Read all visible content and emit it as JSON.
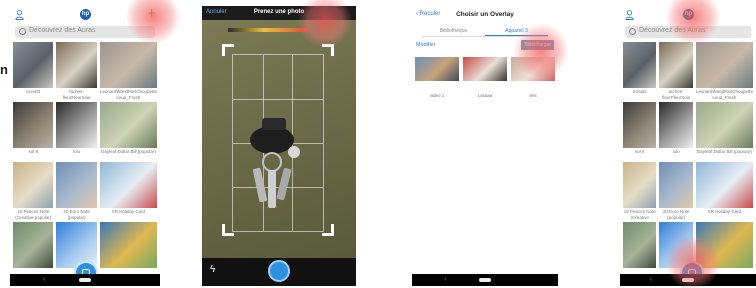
{
  "edge_letter": "n",
  "screen1": {
    "search_placeholder": "Découvrez des Auras",
    "items": [
      {
        "caption": "Ironat3",
        "colors": [
          "#8a8f96",
          "#5b6068",
          "#c9c7c0"
        ]
      },
      {
        "caption": "taches-fleurFleurSoie",
        "colors": [
          "#7a6a55",
          "#d9d2c4",
          "#3d3a35"
        ]
      },
      {
        "caption": "LeonardWandPartChoupette Leua_Fresh",
        "colors": [
          "#9c9590",
          "#c8b9a9",
          "#6a7a80"
        ]
      },
      {
        "caption": "sol 8",
        "colors": [
          "#3b3a3f",
          "#8a8170",
          "#b8b2a8"
        ]
      },
      {
        "caption": "lolo",
        "colors": [
          "#2a2a2a",
          "#9a9a9a",
          "#efefef"
        ]
      },
      {
        "caption": "Dayleaf Dollar Bill (popular)",
        "colors": [
          "#9aa88a",
          "#cfd3b8",
          "#6c7a5a"
        ]
      },
      {
        "caption": "10 Peaces Note (Creative popular)",
        "colors": [
          "#c9b28a",
          "#e6dcc6",
          "#8fa3b0"
        ]
      },
      {
        "caption": "20 Euro Note (popular)",
        "colors": [
          "#6f8fb8",
          "#a9b9cc",
          "#e3c9a8"
        ]
      },
      {
        "caption": "XR Holiday Card",
        "colors": [
          "#8fb6d8",
          "#e8eef5",
          "#c94a4a"
        ]
      },
      {
        "caption": "",
        "colors": [
          "#6f8a6a",
          "#a7b49a",
          "#3d4a3a"
        ]
      },
      {
        "caption": "",
        "colors": [
          "#2f7fd8",
          "#9fc6ee",
          "#e8f2fb"
        ]
      },
      {
        "caption": "",
        "colors": [
          "#3a78b8",
          "#e0b850",
          "#7aa860"
        ]
      }
    ]
  },
  "screen2": {
    "cancel_label": "Annuler",
    "title": "Prenez une photo"
  },
  "screen3": {
    "back_label": "Reculer",
    "title": "Choisir un Overlay",
    "tabs": [
      "Bibliothèque",
      "Appareil 3"
    ],
    "modify_label": "Modifier",
    "upload_label": "Télécharger",
    "items": [
      {
        "caption": "video 1",
        "colors": [
          "#6b8fb8",
          "#c9a27a",
          "#3a4a5a"
        ]
      },
      {
        "caption": "Lasaaa",
        "colors": [
          "#c94a4a",
          "#e8e0d6",
          "#3a3030"
        ]
      },
      {
        "caption": "test",
        "colors": [
          "#c9a89a",
          "#f0e0d8",
          "#d06060"
        ]
      }
    ]
  },
  "screen4": {
    "search_placeholder": "Découvrez des Auras",
    "items": [
      {
        "caption": "Ironat3",
        "colors": [
          "#8a8f96",
          "#5b6068",
          "#c9c7c0"
        ]
      },
      {
        "caption": "taches-fleurFleurSoie",
        "colors": [
          "#7a6a55",
          "#d9d2c4",
          "#3d3a35"
        ]
      },
      {
        "caption": "LeonardWandPartChoupette Leua_Fresh",
        "colors": [
          "#9c9590",
          "#c8b9a9",
          "#6a7a80"
        ]
      },
      {
        "caption": "sol 8",
        "colors": [
          "#3b3a3f",
          "#8a8170",
          "#b8b2a8"
        ]
      },
      {
        "caption": "lolo",
        "colors": [
          "#2a2a2a",
          "#9a9a9a",
          "#efefef"
        ]
      },
      {
        "caption": "Dayleaf Dollar Bill (popular)",
        "colors": [
          "#9aa88a",
          "#cfd3b8",
          "#6c7a5a"
        ]
      },
      {
        "caption": "10 Peaces Note (Creative popular)",
        "colors": [
          "#c9b28a",
          "#e6dcc6",
          "#8fa3b0"
        ]
      },
      {
        "caption": "20 Euro Note (popular)",
        "colors": [
          "#6f8fb8",
          "#a9b9cc",
          "#e3c9a8"
        ]
      },
      {
        "caption": "XR Holiday Card",
        "colors": [
          "#8fb6d8",
          "#e8eef5",
          "#c94a4a"
        ]
      },
      {
        "caption": "",
        "colors": [
          "#6f8a6a",
          "#a7b49a",
          "#3d4a3a"
        ]
      },
      {
        "caption": "",
        "colors": [
          "#2f7fd8",
          "#9fc6ee",
          "#e8f2fb"
        ]
      },
      {
        "caption": "",
        "colors": [
          "#3a78b8",
          "#e0b850",
          "#7aa860"
        ]
      }
    ]
  },
  "colors": {
    "accent": "#2f8fe0",
    "tap_halo": "#f05a5a"
  }
}
